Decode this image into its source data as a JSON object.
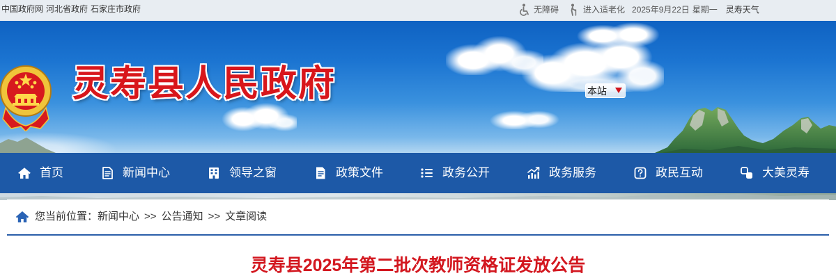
{
  "top_bar": {
    "links": [
      "中国政府网",
      "河北省政府",
      "石家庄市政府"
    ],
    "accessibility": {
      "label": "无障碍",
      "icon": "wheelchair-icon"
    },
    "elderly_mode": {
      "label": "进入适老化",
      "icon": "elderly-icon"
    },
    "date": "2025年9月22日",
    "weekday": "星期一",
    "weather": "灵寿天气"
  },
  "banner": {
    "site_title": "灵寿县人民政府",
    "emblem": "national-emblem-icon",
    "search_scope": {
      "selected": "本站",
      "icon": "dropdown-caret-icon"
    }
  },
  "nav": {
    "items": [
      {
        "label": "首页",
        "icon": "home-icon"
      },
      {
        "label": "新闻中心",
        "icon": "newspaper-icon"
      },
      {
        "label": "领导之窗",
        "icon": "building-icon"
      },
      {
        "label": "政策文件",
        "icon": "document-icon"
      },
      {
        "label": "政务公开",
        "icon": "list-icon"
      },
      {
        "label": "政务服务",
        "icon": "chart-icon"
      },
      {
        "label": "政民互动",
        "icon": "question-icon"
      },
      {
        "label": "大美灵寿",
        "icon": "scenery-icon"
      }
    ]
  },
  "breadcrumb": {
    "icon": "home-icon",
    "prefix": "您当前位置：",
    "separator": ">>",
    "items": [
      "新闻中心",
      "公告通知",
      "文章阅读"
    ]
  },
  "article": {
    "title": "灵寿县2025年第二批次教师资格证发放公告"
  },
  "colors": {
    "top_bar_background": "#e8edf2",
    "nav_background": "#1d59a7",
    "site_title": "#d8161b",
    "article_title": "#d3171f",
    "divider": "#2a5ea9",
    "dropdown_caret": "#d0121b"
  }
}
